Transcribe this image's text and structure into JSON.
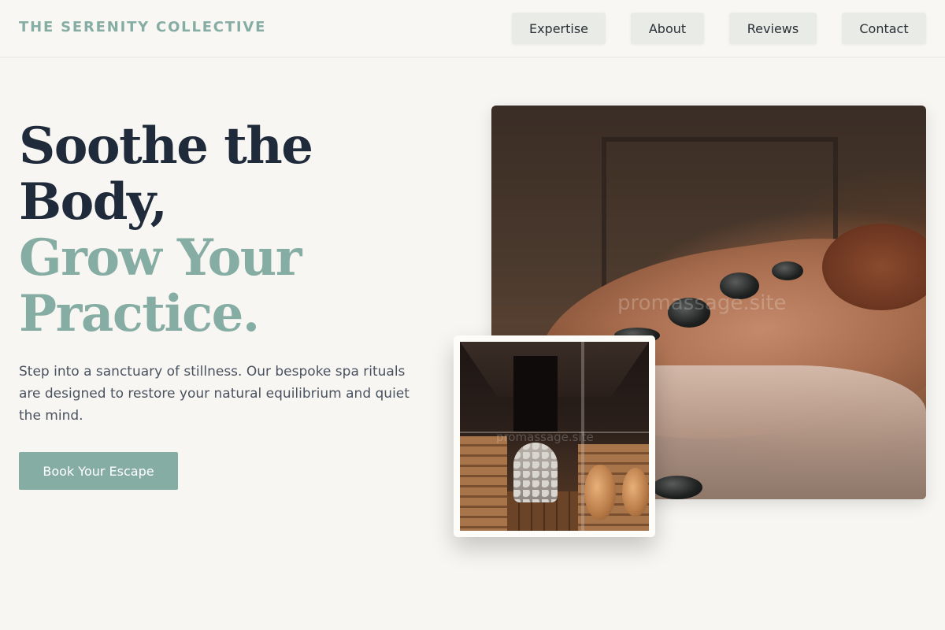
{
  "brand": "THE SERENITY COLLECTIVE",
  "nav": {
    "expertise": "Expertise",
    "about": "About",
    "reviews": "Reviews",
    "contact": "Contact"
  },
  "hero": {
    "title_line1": "Soothe the",
    "title_line2": "Body,",
    "title_line3": "Grow Your",
    "title_line4": "Practice.",
    "description": "Step into a sanctuary of stillness. Our bespoke spa rituals are designed to restore your natural equilibrium and quiet the mind.",
    "cta_label": "Book Your Escape"
  },
  "images": {
    "main_watermark": "promassage.site",
    "inset_watermark": "promassage.site"
  },
  "colors": {
    "accent": "#86ada3",
    "heading_dark": "#1f2a3b",
    "background": "#f7f6f2"
  }
}
